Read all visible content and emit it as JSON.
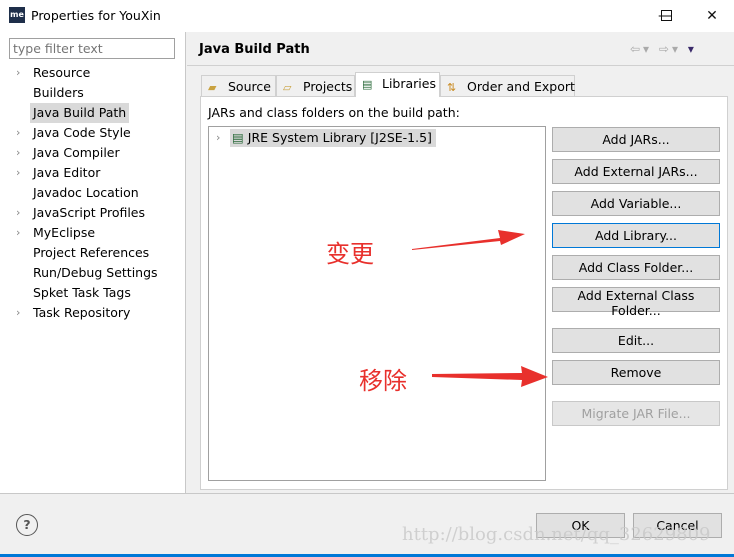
{
  "window": {
    "title": "Properties for YouXin",
    "app_icon": "me"
  },
  "sidebar": {
    "filter_placeholder": "type filter text",
    "items": [
      {
        "label": "Resource",
        "expandable": true
      },
      {
        "label": "Builders",
        "expandable": false
      },
      {
        "label": "Java Build Path",
        "expandable": false,
        "selected": true
      },
      {
        "label": "Java Code Style",
        "expandable": true
      },
      {
        "label": "Java Compiler",
        "expandable": true
      },
      {
        "label": "Java Editor",
        "expandable": true
      },
      {
        "label": "Javadoc Location",
        "expandable": false
      },
      {
        "label": "JavaScript Profiles",
        "expandable": true
      },
      {
        "label": "MyEclipse",
        "expandable": true
      },
      {
        "label": "Project References",
        "expandable": false
      },
      {
        "label": "Run/Debug Settings",
        "expandable": false
      },
      {
        "label": "Spket Task Tags",
        "expandable": false
      },
      {
        "label": "Task Repository",
        "expandable": true
      }
    ]
  },
  "main": {
    "title": "Java Build Path",
    "tabs": [
      {
        "label": "Source"
      },
      {
        "label": "Projects"
      },
      {
        "label": "Libraries",
        "active": true
      },
      {
        "label": "Order and Export"
      }
    ],
    "list_label": "JARs and class folders on the build path:",
    "entries": [
      {
        "label": "JRE System Library [J2SE-1.5]"
      }
    ],
    "buttons": {
      "add_jars": "Add JARs...",
      "add_external_jars": "Add External JARs...",
      "add_variable": "Add Variable...",
      "add_library": "Add Library...",
      "add_class_folder": "Add Class Folder...",
      "add_external_class_folder": "Add External Class Folder...",
      "edit": "Edit...",
      "remove": "Remove",
      "migrate": "Migrate JAR File..."
    }
  },
  "annotations": {
    "change": "变更",
    "remove": "移除",
    "color": "#e8302c"
  },
  "footer": {
    "ok": "OK",
    "cancel": "Cancel",
    "help": "?"
  },
  "watermark": "http://blog.csdn.net/qq_32629809"
}
